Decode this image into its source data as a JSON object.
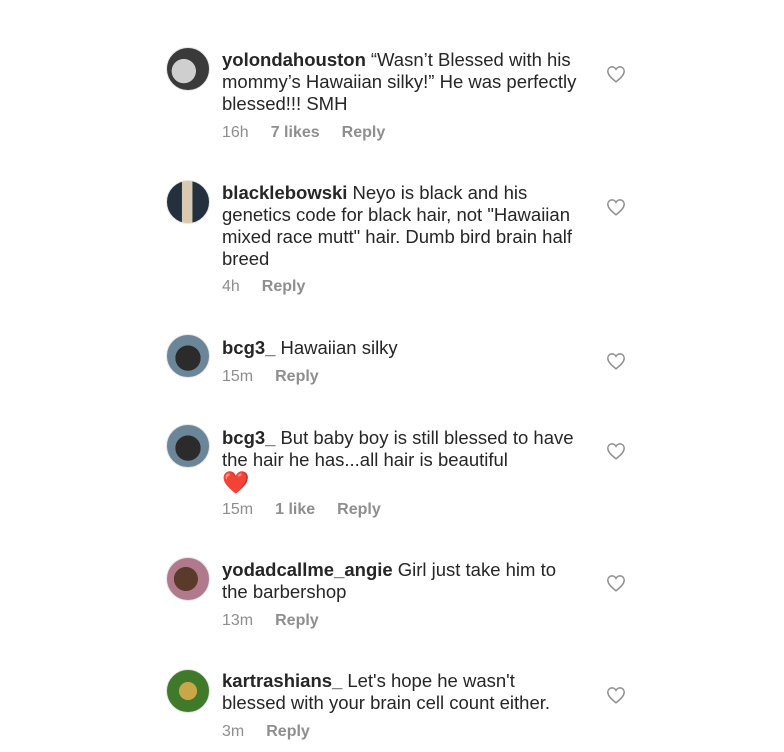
{
  "comments": [
    {
      "username": "yolondahouston",
      "text": "“Wasn’t Blessed with his mommy’s Hawaiian silky!” He was perfectly blessed!!! SMH",
      "emoji": "",
      "time": "16h",
      "likes": "7 likes",
      "reply": "Reply",
      "avatar_colors": [
        "#3a3a3a",
        "#cfcfcf"
      ]
    },
    {
      "username": "blacklebowski",
      "text": "Neyo is black and his genetics code for black hair, not \"Hawaiian mixed race mutt\" hair. Dumb bird brain half breed",
      "emoji": "",
      "time": "4h",
      "likes": "",
      "reply": "Reply",
      "avatar_colors": [
        "#23303d",
        "#d8c9b0"
      ]
    },
    {
      "username": "bcg3_",
      "text": "Hawaiian silky",
      "emoji": "",
      "time": "15m",
      "likes": "",
      "reply": "Reply",
      "avatar_colors": [
        "#6b8599",
        "#2b2b2b"
      ]
    },
    {
      "username": "bcg3_",
      "text": "But baby boy is still blessed to have the hair he has...all hair is beautiful",
      "emoji": "❤️",
      "time": "15m",
      "likes": "1 like",
      "reply": "Reply",
      "avatar_colors": [
        "#6b8599",
        "#2b2b2b"
      ]
    },
    {
      "username": "yodadcallme_angie",
      "text": "Girl just take him to the barbershop",
      "emoji": "",
      "time": "13m",
      "likes": "",
      "reply": "Reply",
      "avatar_colors": [
        "#b07a8c",
        "#5a3a2a"
      ]
    },
    {
      "username": "kartrashians_",
      "text": "Let's hope he wasn't blessed with your brain cell count either.",
      "emoji": "",
      "time": "3m",
      "likes": "",
      "reply": "Reply",
      "avatar_colors": [
        "#3f7a2a",
        "#c9a648"
      ]
    }
  ],
  "like_icon": "heart-outline-icon"
}
